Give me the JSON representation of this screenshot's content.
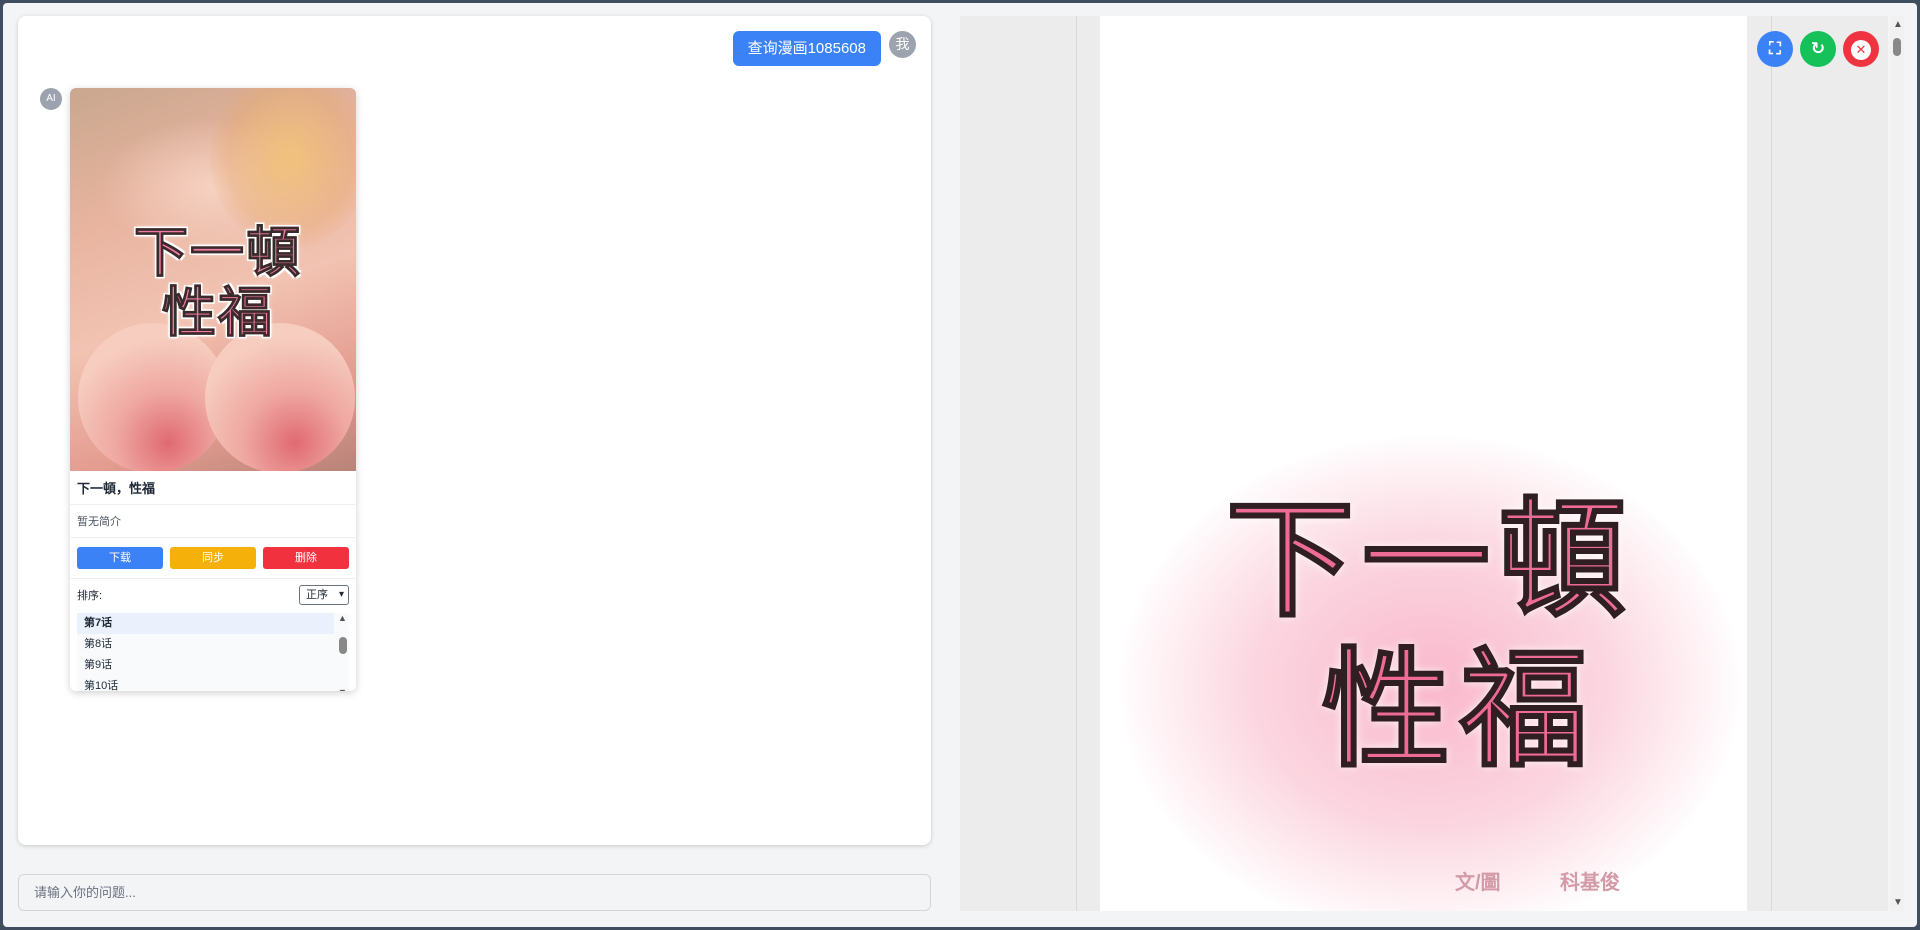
{
  "chat": {
    "user_message": "查询漫画1085608",
    "user_avatar": "我",
    "ai_avatar": "AI",
    "input_placeholder": "请输入你的问题..."
  },
  "card": {
    "title": "下一頓，性福",
    "cover_title_line1": "下一頓",
    "cover_title_line2": "性福",
    "description": "暂无简介",
    "buttons": {
      "download": "下载",
      "sync": "同步",
      "delete": "删除"
    },
    "sort_label": "排序:",
    "sort_value": "正序",
    "episodes": [
      "第7话",
      "第8话",
      "第9话",
      "第10话"
    ]
  },
  "viewer": {
    "page_title_line1": "下一頓",
    "page_title_line2": "性福",
    "credit_label": "文/圖",
    "credit_name": "科基俊",
    "buttons": [
      "fullscreen-icon",
      "refresh-icon",
      "close-icon"
    ]
  },
  "colors": {
    "primary": "#3b82f6",
    "sync": "#f5b10a",
    "danger": "#f2313f",
    "refresh": "#16c15a"
  }
}
